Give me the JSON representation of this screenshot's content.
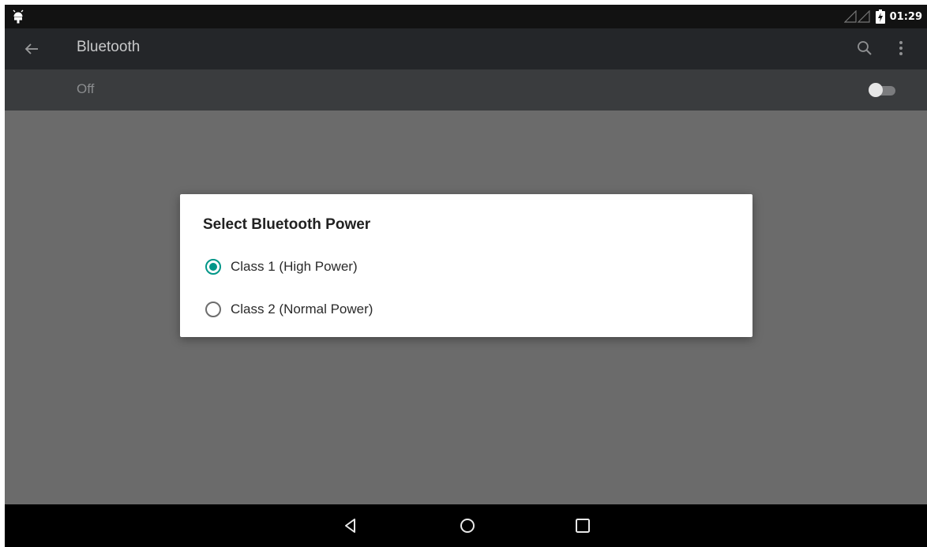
{
  "status_bar": {
    "time": "01:29"
  },
  "toolbar": {
    "title": "Bluetooth"
  },
  "bluetooth_switch": {
    "label": "Off",
    "enabled": false
  },
  "dialog": {
    "title": "Select Bluetooth Power",
    "options": [
      {
        "label": "Class 1 (High Power)",
        "selected": true
      },
      {
        "label": "Class 2 (Normal Power)",
        "selected": false
      }
    ]
  },
  "icons": {
    "status_left": "android-debug-icon",
    "signal": "signal-icon",
    "battery": "battery-icon",
    "back": "arrow-back-icon",
    "search": "search-icon",
    "more": "more-vert-icon",
    "nav_back": "nav-back-icon",
    "nav_home": "nav-home-icon",
    "nav_recents": "nav-recents-icon"
  },
  "colors": {
    "accent": "#009688",
    "toolbar": "#242629",
    "switch_bar": "#3a3c3e",
    "scrim": "#6b6b6b"
  }
}
